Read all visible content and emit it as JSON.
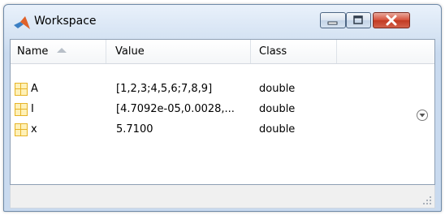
{
  "window": {
    "title": "Workspace",
    "icon": "matlab-logo-icon",
    "controls": [
      "minimize-icon",
      "maximize-icon",
      "close-icon"
    ]
  },
  "table": {
    "columns": [
      {
        "label": "Name",
        "sort": "ascending"
      },
      {
        "label": "Value"
      },
      {
        "label": "Class"
      },
      {
        "label": ""
      }
    ],
    "rows": [
      {
        "name": "A",
        "value": "[1,2,3;4,5,6;7,8,9]",
        "class": "double",
        "icon": "matrix-variable-icon"
      },
      {
        "name": "I",
        "value": "[4.7092e-05,0.0028,...",
        "class": "double",
        "icon": "matrix-variable-icon"
      },
      {
        "name": "x",
        "value": "5.7100",
        "class": "double",
        "icon": "matrix-variable-icon"
      }
    ]
  },
  "actions": {
    "options_icon": "options-dropdown-icon"
  },
  "colors": {
    "titlebar": "#d5e3f3",
    "border": "#6f8aa8",
    "close_button": "#c23a22",
    "variable_icon": "#e6b429"
  }
}
